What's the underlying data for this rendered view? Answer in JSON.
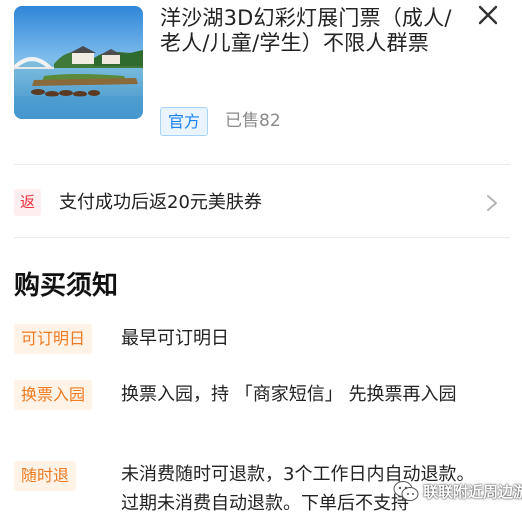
{
  "product": {
    "title": "洋沙湖3D幻彩灯展门票（成人/老人/儿童/学生）不限人群票",
    "badge": "官方",
    "sold": "已售82"
  },
  "rebate": {
    "tag": "返",
    "text": "支付成功后返20元美肤券"
  },
  "notice": {
    "title": "购买须知",
    "items": [
      {
        "tag": "可订明日",
        "text": "最早可订明日"
      },
      {
        "tag": "换票入园",
        "text": "换票入园，持 「商家短信」 先换票再入园"
      },
      {
        "tag": "随时退",
        "text": "未消费随时可退款，3个工作日内自动退款。过期未消费自动退款。下单后不支持"
      }
    ]
  },
  "watermark": {
    "text": "联联附近周边游"
  },
  "icons": {
    "close": "close-icon",
    "chevron": "chevron-right-icon",
    "wechat": "wechat-icon"
  },
  "colors": {
    "badge_blue": "#1a82f0",
    "rebate_red": "#f0303f",
    "notice_orange": "#f07a20"
  }
}
